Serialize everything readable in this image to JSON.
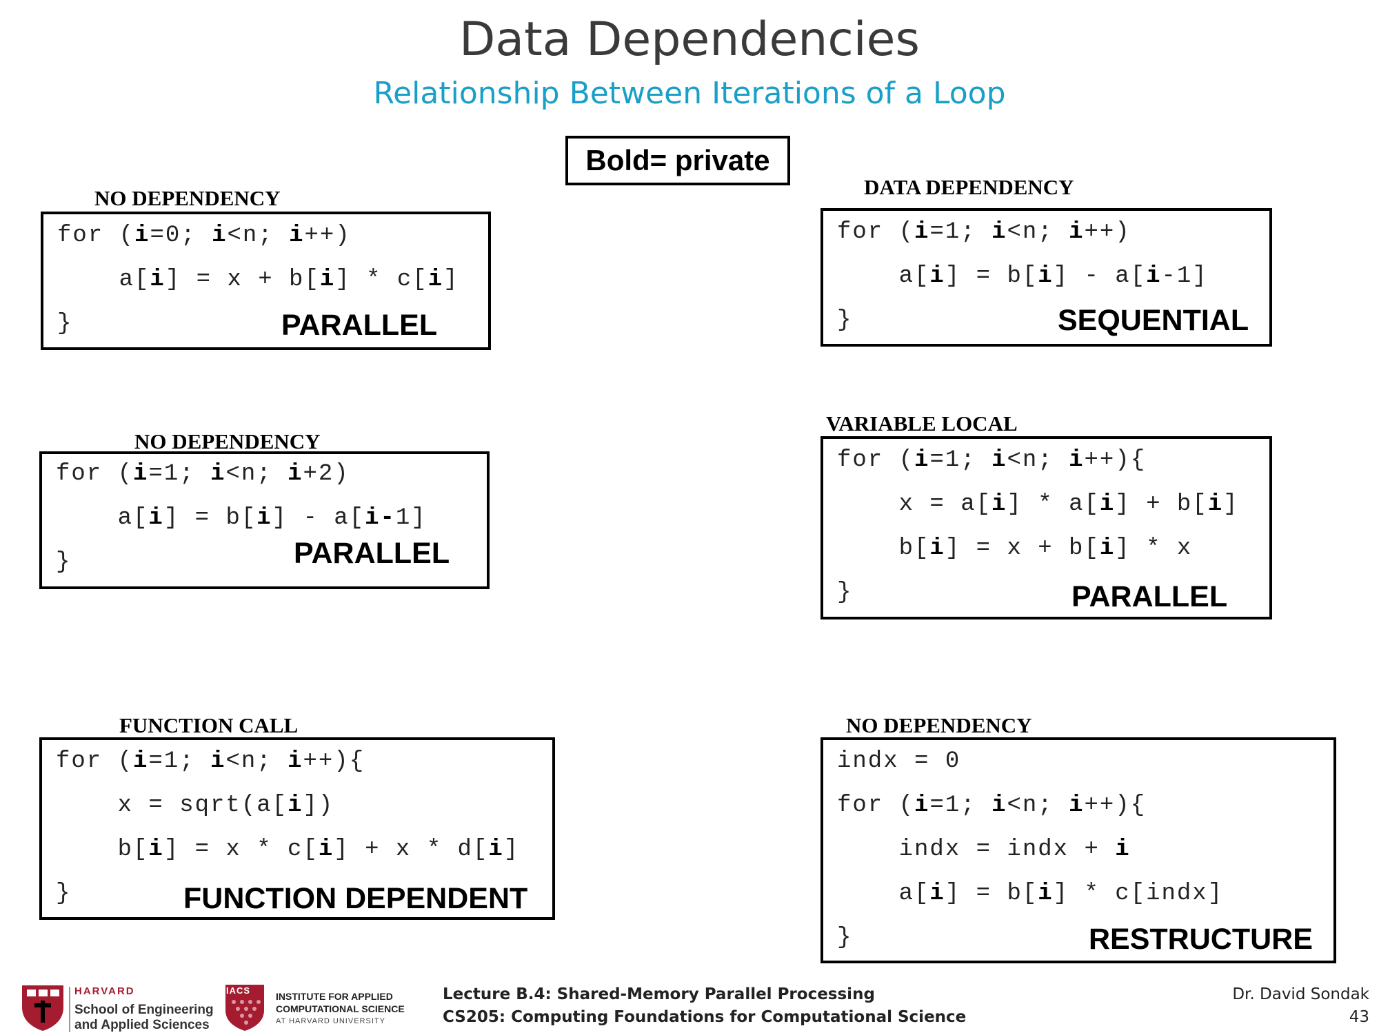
{
  "header": {
    "title": "Data Dependencies",
    "subtitle": "Relationship Between Iterations of a Loop"
  },
  "legend": "Bold= private",
  "panels": [
    {
      "label": "NO DEPENDENCY",
      "lines": [
        [
          [
            "for (",
            false
          ],
          [
            "i",
            true
          ],
          [
            "=0; ",
            false
          ],
          [
            "i",
            true
          ],
          [
            "<n; ",
            false
          ],
          [
            "i",
            true
          ],
          [
            "++)",
            false
          ]
        ],
        [
          [
            "    a[",
            false
          ],
          [
            "i",
            true
          ],
          [
            "] = x + b[",
            false
          ],
          [
            "i",
            true
          ],
          [
            "] * c[",
            false
          ],
          [
            "i",
            true
          ],
          [
            "]",
            false
          ]
        ],
        [
          [
            "}",
            false
          ]
        ]
      ],
      "verdict": "PARALLEL"
    },
    {
      "label": "DATA DEPENDENCY",
      "lines": [
        [
          [
            "for (",
            false
          ],
          [
            "i",
            true
          ],
          [
            "=1; ",
            false
          ],
          [
            "i",
            true
          ],
          [
            "<n; ",
            false
          ],
          [
            "i",
            true
          ],
          [
            "++)",
            false
          ]
        ],
        [
          [
            "    a[",
            false
          ],
          [
            "i",
            true
          ],
          [
            "] = b[",
            false
          ],
          [
            "i",
            true
          ],
          [
            "] - a[",
            false
          ],
          [
            "i",
            true
          ],
          [
            "-1]",
            false
          ]
        ],
        [
          [
            "}",
            false
          ]
        ]
      ],
      "verdict": "SEQUENTIAL"
    },
    {
      "label": "NO DEPENDENCY",
      "lines": [
        [
          [
            "for (",
            false
          ],
          [
            "i",
            true
          ],
          [
            "=1; ",
            false
          ],
          [
            "i",
            true
          ],
          [
            "<n; ",
            false
          ],
          [
            "i",
            true
          ],
          [
            "+2)",
            false
          ]
        ],
        [
          [
            "    a[",
            false
          ],
          [
            "i",
            true
          ],
          [
            "] = b[",
            false
          ],
          [
            "i",
            true
          ],
          [
            "] - a[",
            false
          ],
          [
            "i-",
            true
          ],
          [
            "1]",
            false
          ]
        ],
        [
          [
            "}",
            false
          ]
        ]
      ],
      "verdict": "PARALLEL"
    },
    {
      "label": "VARIABLE LOCAL",
      "lines": [
        [
          [
            "for (",
            false
          ],
          [
            "i",
            true
          ],
          [
            "=1; ",
            false
          ],
          [
            "i",
            true
          ],
          [
            "<n; ",
            false
          ],
          [
            "i",
            true
          ],
          [
            "++){",
            false
          ]
        ],
        [
          [
            "    x = a[",
            false
          ],
          [
            "i",
            true
          ],
          [
            "] * a[",
            false
          ],
          [
            "i",
            true
          ],
          [
            "] + b[",
            false
          ],
          [
            "i",
            true
          ],
          [
            "]",
            false
          ]
        ],
        [
          [
            "    b[",
            false
          ],
          [
            "i",
            true
          ],
          [
            "] = x + b[",
            false
          ],
          [
            "i",
            true
          ],
          [
            "] * x",
            false
          ]
        ],
        [
          [
            "}",
            false
          ]
        ]
      ],
      "verdict": "PARALLEL"
    },
    {
      "label": "FUNCTION CALL",
      "lines": [
        [
          [
            "for (",
            false
          ],
          [
            "i",
            true
          ],
          [
            "=1; ",
            false
          ],
          [
            "i",
            true
          ],
          [
            "<n; ",
            false
          ],
          [
            "i",
            true
          ],
          [
            "++){",
            false
          ]
        ],
        [
          [
            "    x = sqrt(a[",
            false
          ],
          [
            "i",
            true
          ],
          [
            "])",
            false
          ]
        ],
        [
          [
            "    b[",
            false
          ],
          [
            "i",
            true
          ],
          [
            "] = x * c[",
            false
          ],
          [
            "i",
            true
          ],
          [
            "] + x * d[",
            false
          ],
          [
            "i",
            true
          ],
          [
            "]",
            false
          ]
        ],
        [
          [
            "}",
            false
          ]
        ]
      ],
      "verdict": "FUNCTION DEPENDENT"
    },
    {
      "label": "NO DEPENDENCY",
      "lines": [
        [
          [
            "indx = 0",
            false
          ]
        ],
        [
          [
            "for (",
            false
          ],
          [
            "i",
            true
          ],
          [
            "=1; ",
            false
          ],
          [
            "i",
            true
          ],
          [
            "<n; ",
            false
          ],
          [
            "i",
            true
          ],
          [
            "++){",
            false
          ]
        ],
        [
          [
            "    indx = indx + ",
            false
          ],
          [
            "i",
            true
          ]
        ],
        [
          [
            "    a[",
            false
          ],
          [
            "i",
            true
          ],
          [
            "] = b[",
            false
          ],
          [
            "i",
            true
          ],
          [
            "] * c[indx]",
            false
          ]
        ],
        [
          [
            "}",
            false
          ]
        ]
      ],
      "verdict": "RESTRUCTURE"
    }
  ],
  "footer": {
    "seas_top": "HARVARD",
    "seas_line1": "School of Engineering",
    "seas_line2": "and Applied Sciences",
    "iacs_badge": "IACS",
    "iacs_line1": "INSTITUTE FOR APPLIED",
    "iacs_line2": "COMPUTATIONAL SCIENCE",
    "iacs_line3": "AT HARVARD UNIVERSITY",
    "lecture": "Lecture B.4: Shared-Memory Parallel Processing",
    "course": "CS205: Computing Foundations for Computational Science",
    "author": "Dr. David Sondak",
    "page": "43"
  }
}
